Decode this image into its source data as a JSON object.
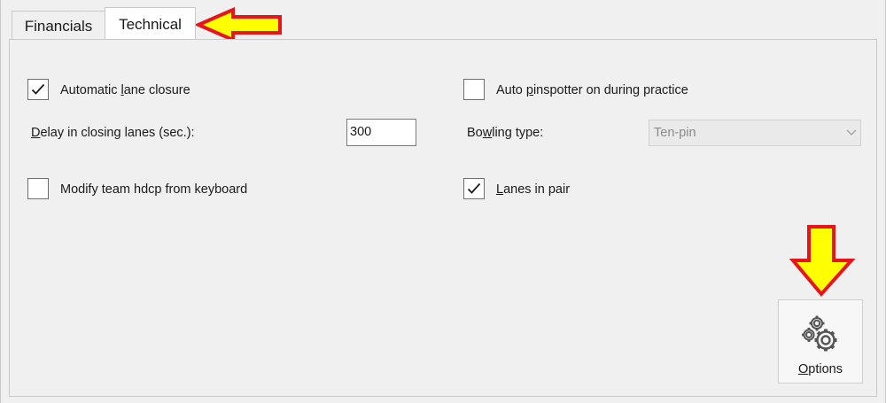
{
  "tabs": [
    {
      "label": "Financials",
      "active": false
    },
    {
      "label": "Technical",
      "active": true
    }
  ],
  "options": {
    "automatic_lane_closure": {
      "pre": "Automatic ",
      "key": "l",
      "post": "ane closure",
      "checked": true
    },
    "auto_pinspotter": {
      "pre": "Auto ",
      "key": "p",
      "post": "inspotter on during practice",
      "checked": false
    },
    "delay_closing": {
      "pre": "",
      "key": "D",
      "post": "elay in closing lanes (sec.):",
      "value": "300"
    },
    "bowling_type": {
      "pre": "Bo",
      "key": "w",
      "post": "ling type:",
      "value": "Ten-pin"
    },
    "modify_team_hdcp": {
      "pre": "",
      "key": "",
      "post": "Modify team hdcp from keyboard",
      "checked": false
    },
    "lanes_in_pair": {
      "pre": "",
      "key": "L",
      "post": "anes in pair",
      "checked": true
    }
  },
  "options_button": {
    "key": "O",
    "post": "ptions",
    "icon": "gears-icon"
  },
  "annotation_color": {
    "fill": "#ffff00",
    "stroke": "#e8141c"
  }
}
